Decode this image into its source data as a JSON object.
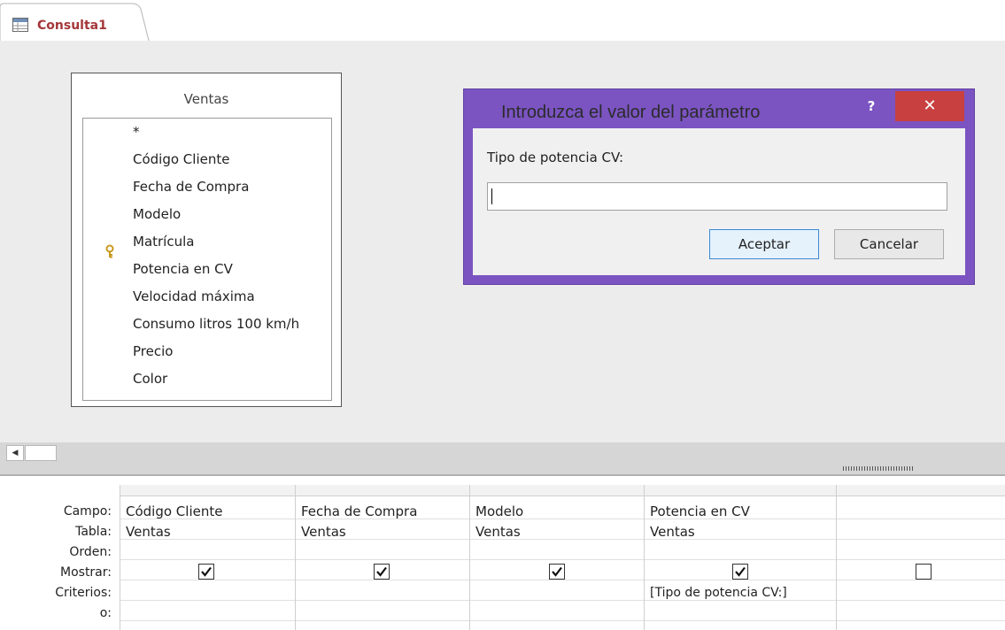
{
  "tab": {
    "label": "Consulta1",
    "icon": "query-icon"
  },
  "table": {
    "title": "Ventas",
    "fields": [
      "*",
      "Código Cliente",
      "Fecha de Compra",
      "Modelo",
      "Matrícula",
      "Potencia en CV",
      "Velocidad máxima",
      "Consumo litros 100 km/h",
      "Precio",
      "Color"
    ],
    "primary_key_field": "Matrícula"
  },
  "dialog": {
    "title": "Introduzca el valor del parámetro",
    "help": "?",
    "close": "✕",
    "prompt": "Tipo de potencia CV:",
    "input_value": "",
    "ok_label": "Aceptar",
    "cancel_label": "Cancelar",
    "accent_color": "#7b54c2"
  },
  "grid": {
    "row_labels": [
      "Campo:",
      "Tabla:",
      "Orden:",
      "Mostrar:",
      "Criterios:",
      "o:"
    ],
    "columns": [
      {
        "campo": "Código Cliente",
        "tabla": "Ventas",
        "mostrar": true,
        "criterios": ""
      },
      {
        "campo": "Fecha de Compra",
        "tabla": "Ventas",
        "mostrar": true,
        "criterios": ""
      },
      {
        "campo": "Modelo",
        "tabla": "Ventas",
        "mostrar": true,
        "criterios": ""
      },
      {
        "campo": "Potencia en CV",
        "tabla": "Ventas",
        "mostrar": true,
        "criterios": "[Tipo de potencia CV:]"
      },
      {
        "campo": "",
        "tabla": "",
        "mostrar": false,
        "criterios": ""
      }
    ]
  }
}
